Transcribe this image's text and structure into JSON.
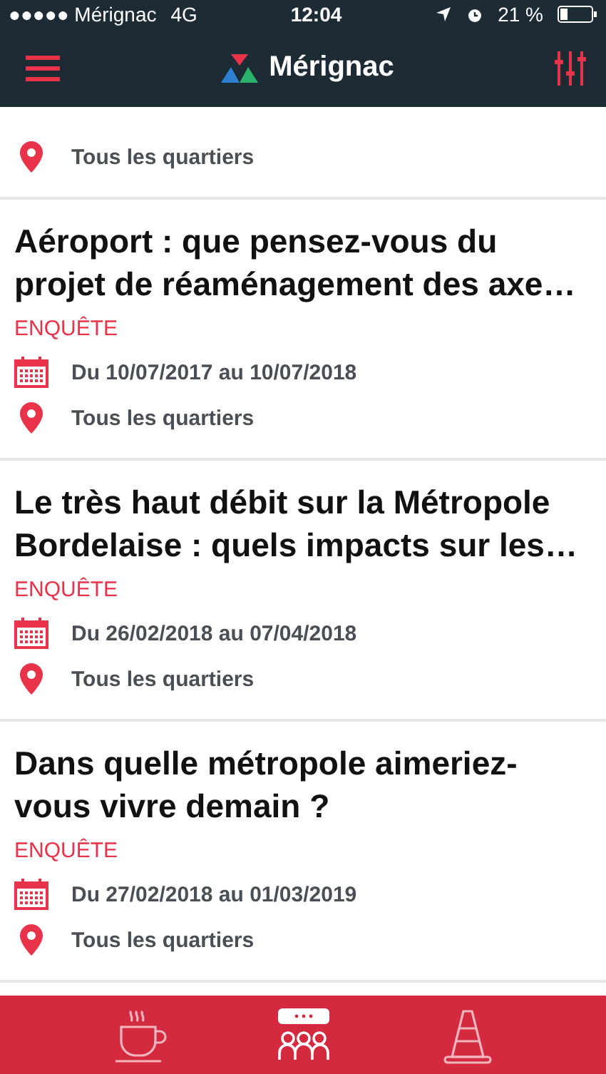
{
  "status_bar": {
    "carrier": "●●●●● Mérignac",
    "network": "4G",
    "time": "12:04",
    "battery_text": "21 %"
  },
  "header": {
    "title": "Mérignac"
  },
  "partial_card": {
    "location": "Tous les quartiers"
  },
  "cards": [
    {
      "title": "Aéroport : que pensez-vous du projet de réaménagement des axe…",
      "category": "ENQUÊTE",
      "date": "Du 10/07/2017 au 10/07/2018",
      "location": "Tous les quartiers"
    },
    {
      "title": "Le très haut débit sur la Métropole Bordelaise : quels impacts sur les…",
      "category": "ENQUÊTE",
      "date": "Du 26/02/2018 au 07/04/2018",
      "location": "Tous les quartiers"
    },
    {
      "title": "Dans quelle métropole aimeriez-vous vivre demain ?",
      "category": "ENQUÊTE",
      "date": "Du 27/02/2018 au 01/03/2019",
      "location": "Tous les quartiers"
    }
  ],
  "tab_bar": [
    {
      "kind": "cup",
      "selected": false
    },
    {
      "kind": "meeting",
      "selected": true
    },
    {
      "kind": "cone",
      "selected": false
    }
  ]
}
